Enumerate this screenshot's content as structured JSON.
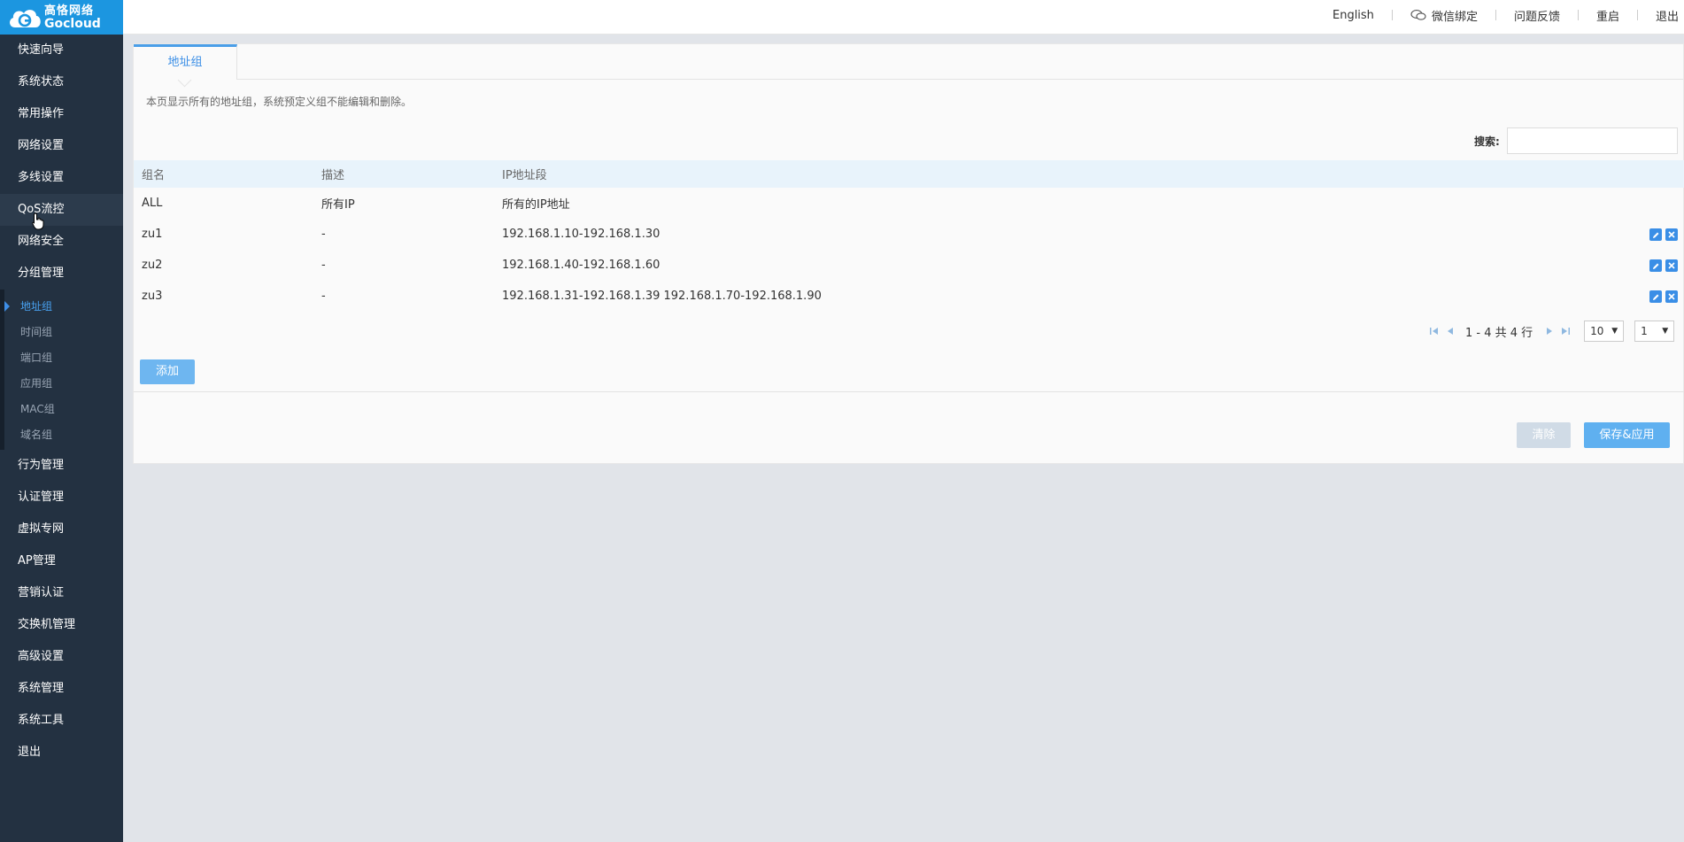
{
  "brand": {
    "name_cn": "高恪网络",
    "name_en": "Gocloud"
  },
  "topnav": {
    "english": "English",
    "wechat": "微信绑定",
    "feedback": "问题反馈",
    "reboot": "重启",
    "logout": "退出"
  },
  "sidebar": {
    "items_top": [
      "快速向导",
      "系统状态",
      "常用操作",
      "网络设置",
      "多线设置",
      "QoS流控",
      "网络安全",
      "分组管理"
    ],
    "submenu": [
      "地址组",
      "时间组",
      "端口组",
      "应用组",
      "MAC组",
      "域名组"
    ],
    "items_bottom": [
      "行为管理",
      "认证管理",
      "虚拟专网",
      "AP管理",
      "营销认证",
      "交换机管理",
      "高级设置",
      "系统管理",
      "系统工具",
      "退出"
    ]
  },
  "tab": {
    "label": "地址组"
  },
  "description": "本页显示所有的地址组，系统预定义组不能编辑和删除。",
  "search": {
    "label": "搜索:",
    "value": ""
  },
  "table": {
    "headers": [
      "组名",
      "描述",
      "IP地址段"
    ],
    "rows": [
      {
        "name": "ALL",
        "desc": "所有IP",
        "ip": "所有的IP地址"
      },
      {
        "name": "zu1",
        "desc": "-",
        "ip": "192.168.1.10-192.168.1.30"
      },
      {
        "name": "zu2",
        "desc": "-",
        "ip": "192.168.1.40-192.168.1.60"
      },
      {
        "name": "zu3",
        "desc": "-",
        "ip": "192.168.1.31-192.168.1.39 192.168.1.70-192.168.1.90"
      }
    ]
  },
  "pager": {
    "summary": "1 - 4 共 4 行",
    "page_size": "10",
    "page": "1"
  },
  "buttons": {
    "add": "添加",
    "clear": "清除",
    "save": "保存&应用"
  }
}
